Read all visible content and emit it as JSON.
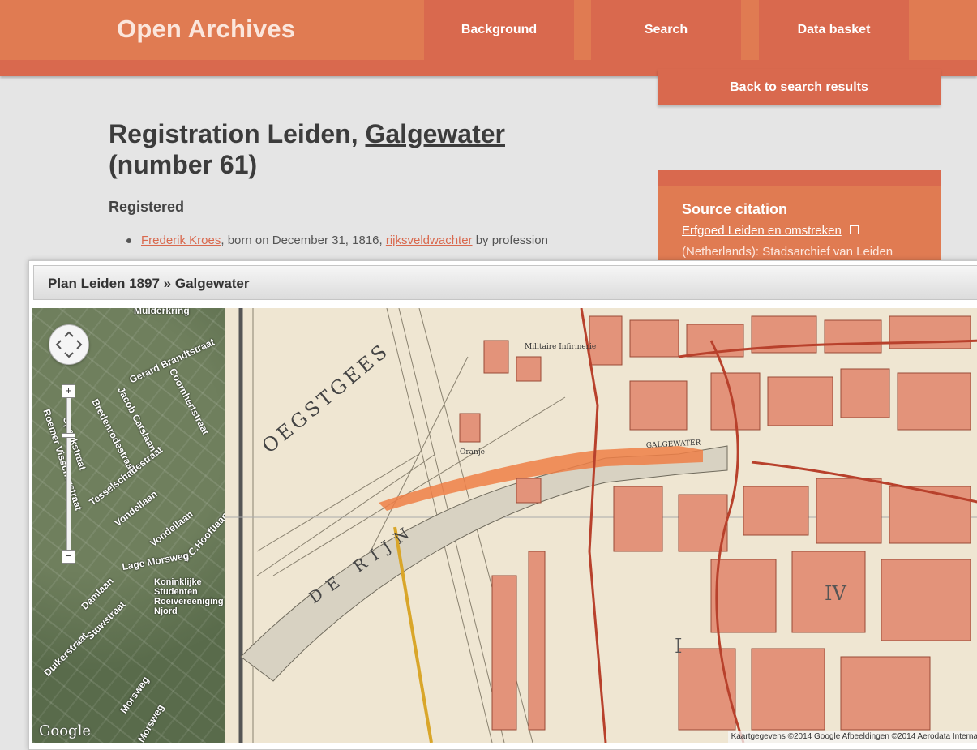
{
  "header": {
    "brand": "Open Archives",
    "nav": [
      "Background",
      "Search",
      "Data basket"
    ],
    "back_label": "Back to search results"
  },
  "record": {
    "title_prefix": "Registration Leiden, ",
    "title_link": "Galgewater",
    "title_suffix": "(number 61)",
    "section": "Registered",
    "person_name": "Frederik Kroes",
    "person_mid": ", born on December 31, 1816, ",
    "profession": "rijksveldwachter",
    "person_end": " by profession"
  },
  "source": {
    "heading": "Source citation",
    "link": "Erfgoed Leiden en omstreken",
    "org": "(Netherlands): Stadsarchief van Leiden"
  },
  "map_dialog": {
    "title": "Plan Leiden 1897 » Galgewater",
    "logo": "Google",
    "attribution": "Kaartgegevens ©2014 Google Afbeeldingen ©2014 Aerodata Interna",
    "aerial_labels": [
      "Mulderkring",
      "Gerard Brandtstraat",
      "Coornhertstraat",
      "Jacob Catslaan",
      "Bredenrodestraat",
      "Speykstraat",
      "Tesselschadestraat",
      "Vondellaan",
      "Vondellaan",
      "P.C.Hooftlaan",
      "Lage Morsweg",
      "Damlaan",
      "Koninklijke Studenten Roeivereeniging Njord",
      "Stuwstraat",
      "Duikerstraat",
      "Morsweg",
      "Roemer Visscherstraat",
      "Morsweg"
    ],
    "oldmap_labels": [
      "OEGSTGEES",
      "DE RIJN",
      "GALGEWATER",
      "Militaire Infirmerie",
      "Oranje",
      "IV",
      "I"
    ]
  },
  "colors": {
    "accent": "#d9694e",
    "accent_light": "#e07b52",
    "background": "#e5e5e5"
  }
}
